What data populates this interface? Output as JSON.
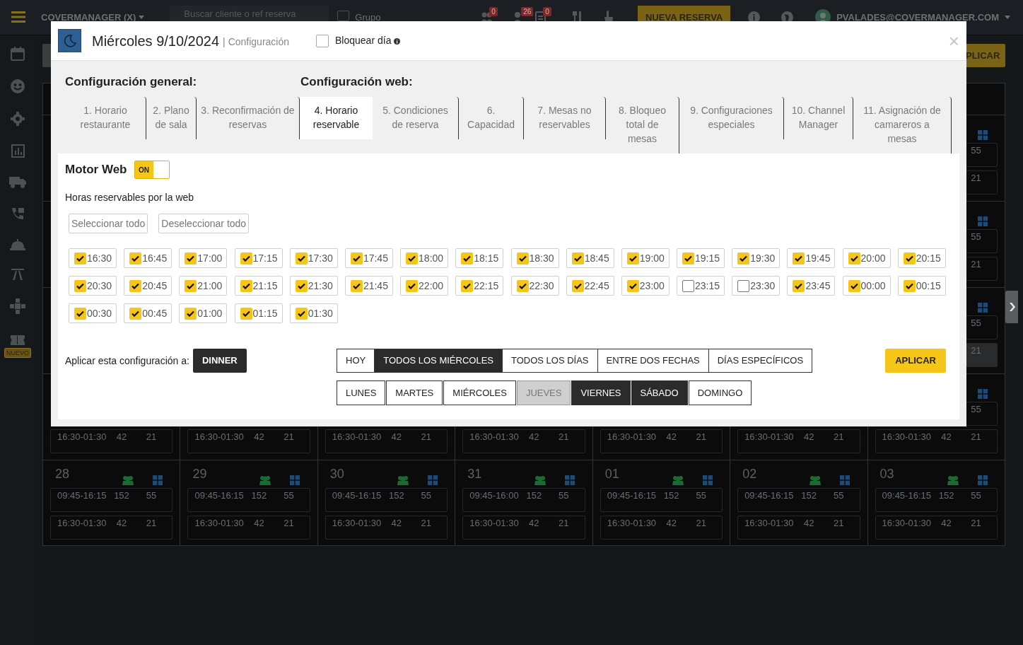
{
  "topbar": {
    "brand": "COVERMANAGER (X)",
    "search": {
      "placeholder": "Buscar cliente o ref reserva"
    },
    "group_checkbox": {
      "label": "Grupo",
      "checked": false
    },
    "notification_badges": [
      "0",
      "26",
      "0"
    ],
    "new_button": "NUEVA RESERVA",
    "user": "PVALADES@COVERMANAGER.COM"
  },
  "sidebar": {
    "new_badge": "NUEVO"
  },
  "toolbar": {
    "apply_button": "PLICAR"
  },
  "calendar": {
    "weeks": [
      {
        "last_day": {
          "first_slot": {
            "tables": "55"
          },
          "second_slot": {
            "tables": "21",
            "highlighted": false
          }
        }
      },
      {
        "last_day": {
          "first_slot": {
            "tables": "55"
          },
          "second_slot": {
            "tables": "21",
            "highlighted": false
          }
        }
      },
      {
        "last_day": {
          "first_slot": {
            "tables": "55"
          },
          "second_slot": {
            "tables": "21",
            "highlighted": true
          }
        }
      },
      {
        "days": [
          {
            "second_slot": {
              "time": "16:30-01:30",
              "covers": "42",
              "tables": "21"
            }
          },
          {
            "second_slot": {
              "time": "16:30-01:30",
              "covers": "42",
              "tables": "21"
            }
          },
          {
            "second_slot": {
              "time": "16:30-01:30",
              "covers": "42",
              "tables": "21"
            }
          },
          {
            "second_slot": {
              "time": "16:30-01:30",
              "covers": "42",
              "tables": "21"
            }
          },
          {
            "second_slot": {
              "time": "16:30-01:30",
              "covers": "42",
              "tables": "21"
            }
          },
          {
            "second_slot": {
              "time": "16:30-01:30",
              "covers": "42",
              "tables": "21"
            }
          },
          {
            "first_slot": {
              "tables": "55"
            },
            "second_slot": {
              "time": "16:30-01:30",
              "covers": "42",
              "tables": "21"
            }
          }
        ]
      },
      {
        "days": [
          {
            "date": "28",
            "first_slot": {
              "time": "09:45-16:15",
              "covers": "152",
              "tables": "55"
            },
            "second_slot": {
              "time": "16:30-01:30",
              "covers": "42",
              "tables": "21"
            }
          },
          {
            "date": "29",
            "first_slot": {
              "time": "09:45-16:15",
              "covers": "152",
              "tables": "55"
            },
            "second_slot": {
              "time": "16:30-01:30",
              "covers": "42",
              "tables": "21"
            }
          },
          {
            "date": "30",
            "first_slot": {
              "time": "09:45-16:15",
              "covers": "152",
              "tables": "55"
            },
            "second_slot": {
              "time": "16:30-01:30",
              "covers": "42",
              "tables": "21"
            }
          },
          {
            "date": "31",
            "first_slot": {
              "time": "09:45-16:00",
              "covers": "152",
              "tables": "55"
            },
            "second_slot": {
              "time": "16:30-01:30",
              "covers": "42",
              "tables": "21"
            }
          },
          {
            "date": "01",
            "first_slot": {
              "time": "09:45-16:15",
              "covers": "152",
              "tables": "55"
            },
            "second_slot": {
              "time": "16:30-01:30",
              "covers": "42",
              "tables": "21"
            }
          },
          {
            "date": "02",
            "first_slot": {
              "time": "09:45-16:15",
              "covers": "152",
              "tables": "55"
            },
            "second_slot": {
              "time": "16:30-01:30",
              "covers": "42",
              "tables": "21"
            }
          },
          {
            "date": "03",
            "first_slot": {
              "time": "09:45-16:15",
              "covers": "152",
              "tables": "55"
            },
            "second_slot": {
              "time": "16:30-01:30",
              "covers": "42",
              "tables": "21"
            }
          }
        ]
      }
    ]
  },
  "modal": {
    "title": "Miércoles 9/10/2024",
    "subtitle": "| Configuración",
    "block_day": {
      "label": "Bloquear día",
      "checked": false
    },
    "close": "×",
    "sections": [
      "Configuración general:",
      "Configuración web:"
    ],
    "tabs": [
      {
        "label": "1. Horario restaurante",
        "selected": false
      },
      {
        "label": "2. Plano de sala",
        "selected": false
      },
      {
        "label": "3. Reconfirmación de reservas",
        "selected": false
      },
      {
        "label": "4. Horario reservable",
        "selected": true
      },
      {
        "label": "5. Condiciones de reserva",
        "selected": false
      },
      {
        "label": "6. Capacidad",
        "selected": false
      },
      {
        "label": "7. Mesas no reservables",
        "selected": false
      },
      {
        "label": "8. Bloqueo total de mesas",
        "selected": false
      },
      {
        "label": "9. Configuraciones especiales",
        "selected": false
      },
      {
        "label": "10. Channel Manager",
        "selected": false
      },
      {
        "label": "11. Asignación de camareros a mesas",
        "selected": false
      }
    ],
    "motor_web": {
      "label": "Motor Web",
      "on": true,
      "toggle_text": "ON"
    },
    "hours_label": "Horas reservables por la web",
    "select_all": "Seleccionar todo",
    "deselect_all": "Deseleccionar todo",
    "hours": [
      {
        "time": "16:30",
        "checked": true
      },
      {
        "time": "16:45",
        "checked": true
      },
      {
        "time": "17:00",
        "checked": true
      },
      {
        "time": "17:15",
        "checked": true
      },
      {
        "time": "17:30",
        "checked": true
      },
      {
        "time": "17:45",
        "checked": true
      },
      {
        "time": "18:00",
        "checked": true
      },
      {
        "time": "18:15",
        "checked": true
      },
      {
        "time": "18:30",
        "checked": true
      },
      {
        "time": "18:45",
        "checked": true
      },
      {
        "time": "19:00",
        "checked": true
      },
      {
        "time": "19:15",
        "checked": true
      },
      {
        "time": "19:30",
        "checked": true
      },
      {
        "time": "19:45",
        "checked": true
      },
      {
        "time": "20:00",
        "checked": true
      },
      {
        "time": "20:15",
        "checked": true
      },
      {
        "time": "20:30",
        "checked": true
      },
      {
        "time": "20:45",
        "checked": true
      },
      {
        "time": "21:00",
        "checked": true
      },
      {
        "time": "21:15",
        "checked": true
      },
      {
        "time": "21:30",
        "checked": true
      },
      {
        "time": "21:45",
        "checked": true
      },
      {
        "time": "22:00",
        "checked": true
      },
      {
        "time": "22:15",
        "checked": true
      },
      {
        "time": "22:30",
        "checked": true
      },
      {
        "time": "22:45",
        "checked": true
      },
      {
        "time": "23:00",
        "checked": true
      },
      {
        "time": "23:15",
        "checked": false
      },
      {
        "time": "23:30",
        "checked": false
      },
      {
        "time": "23:45",
        "checked": true
      },
      {
        "time": "00:00",
        "checked": true
      },
      {
        "time": "00:15",
        "checked": true
      },
      {
        "time": "00:30",
        "checked": true
      },
      {
        "time": "00:45",
        "checked": true
      },
      {
        "time": "01:00",
        "checked": true
      },
      {
        "time": "01:15",
        "checked": true
      },
      {
        "time": "01:30",
        "checked": true
      }
    ],
    "apply_label": "Aplicar esta configuración a:",
    "service": "DINNER",
    "scope_options": [
      {
        "label": "HOY",
        "selected": false
      },
      {
        "label": "TODOS LOS MIÉRCOLES",
        "selected": true
      },
      {
        "label": "TODOS LOS DÍAS",
        "selected": false
      },
      {
        "label": "ENTRE DOS FECHAS",
        "selected": false
      },
      {
        "label": "DÍAS ESPECÍFICOS",
        "selected": false
      }
    ],
    "weekdays": [
      {
        "label": "LUNES",
        "selected": false,
        "disabled": false
      },
      {
        "label": "MARTES",
        "selected": false,
        "disabled": false
      },
      {
        "label": "MIÉRCOLES",
        "selected": false,
        "disabled": false
      },
      {
        "label": "JUEVES",
        "selected": false,
        "disabled": true
      },
      {
        "label": "VIERNES",
        "selected": true,
        "disabled": false
      },
      {
        "label": "SÁBADO",
        "selected": true,
        "disabled": false
      },
      {
        "label": "DOMINGO",
        "selected": false,
        "disabled": false
      }
    ],
    "apply_button": "APLICAR"
  }
}
